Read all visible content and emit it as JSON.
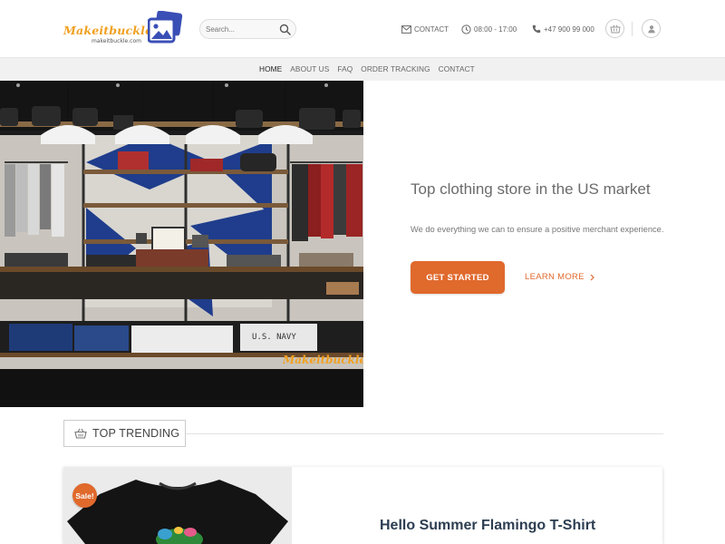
{
  "header": {
    "logo_text": "Makeitbuckle",
    "logo_subtext": "makeitbuckle.com",
    "search_placeholder": "Search...",
    "contact_label": "CONTACT",
    "hours_label": "08:00 - 17:00",
    "phone_label": "+47 900 99 000",
    "icons": [
      "search-icon",
      "mail-icon",
      "clock-icon",
      "phone-icon",
      "cart-icon",
      "user-icon"
    ]
  },
  "nav": {
    "items": [
      {
        "label": "HOME",
        "active": true
      },
      {
        "label": "ABOUT US",
        "active": false
      },
      {
        "label": "FAQ",
        "active": false
      },
      {
        "label": "ORDER TRACKING",
        "active": false
      },
      {
        "label": "CONTACT",
        "active": false
      }
    ]
  },
  "hero": {
    "watermark": "Makeitbuckle",
    "title": "Top clothing store in the US market",
    "subtitle": "We do everything we can to ensure a positive merchant experience.",
    "primary_button": "GET STARTED",
    "secondary_button": "LEARN MORE",
    "secondary_icon": "chevron-right-icon"
  },
  "trending": {
    "label": "TOP TRENDING",
    "icon": "basket-icon"
  },
  "product": {
    "badge": "Sale!",
    "name": "Hello Summer Flamingo T-Shirt"
  },
  "colors": {
    "accent": "#e0692c",
    "logo": "#f0a020",
    "logo_mark": "#3a4fb5",
    "product_title": "#2d3e52",
    "nav_bg": "#f1f1f1"
  }
}
